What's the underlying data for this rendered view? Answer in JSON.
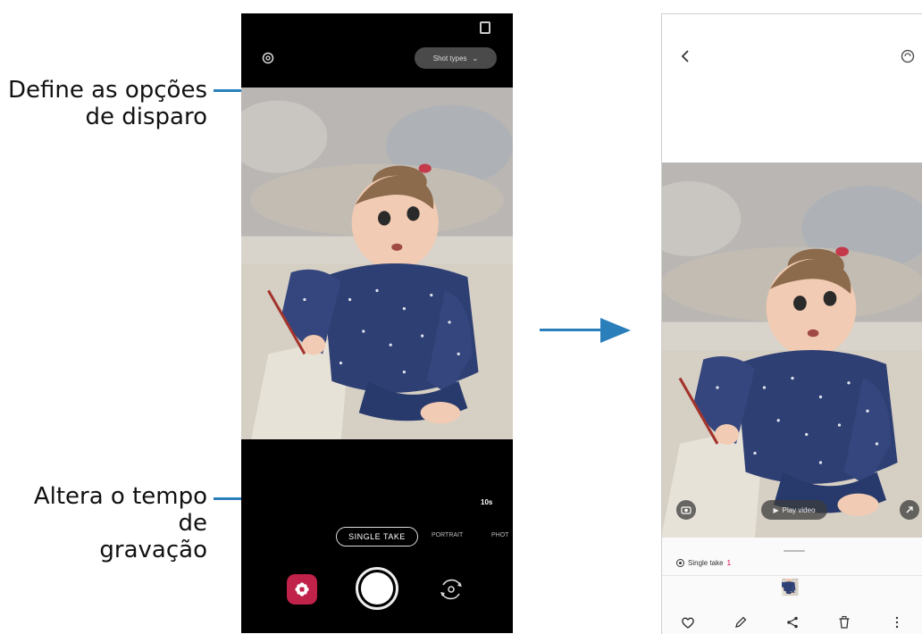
{
  "callouts": {
    "shot_options": {
      "line1": "Define as opções",
      "line2": "de disparo"
    },
    "recording_time": {
      "line1": "Altera o tempo de",
      "line2": "gravação"
    }
  },
  "camera": {
    "shot_types_label": "Shot types",
    "timer_label": "10s",
    "modes": {
      "single_take": "SINGLE TAKE",
      "portrait": "PORTRAIT",
      "photo": "PHOT"
    },
    "icons": [
      "settings-icon",
      "chevron-down-icon",
      "gallery-icon",
      "shutter-button",
      "switch-camera-icon"
    ]
  },
  "viewer": {
    "play_video_label": "Play video",
    "single_take_label": "Single take",
    "single_take_count": "1",
    "toolbar_icons": [
      "heart-icon",
      "edit-icon",
      "share-icon",
      "delete-icon",
      "more-icon"
    ]
  },
  "colors": {
    "accent_blue": "#2a7fba",
    "gallery_red": "#c0224a"
  }
}
